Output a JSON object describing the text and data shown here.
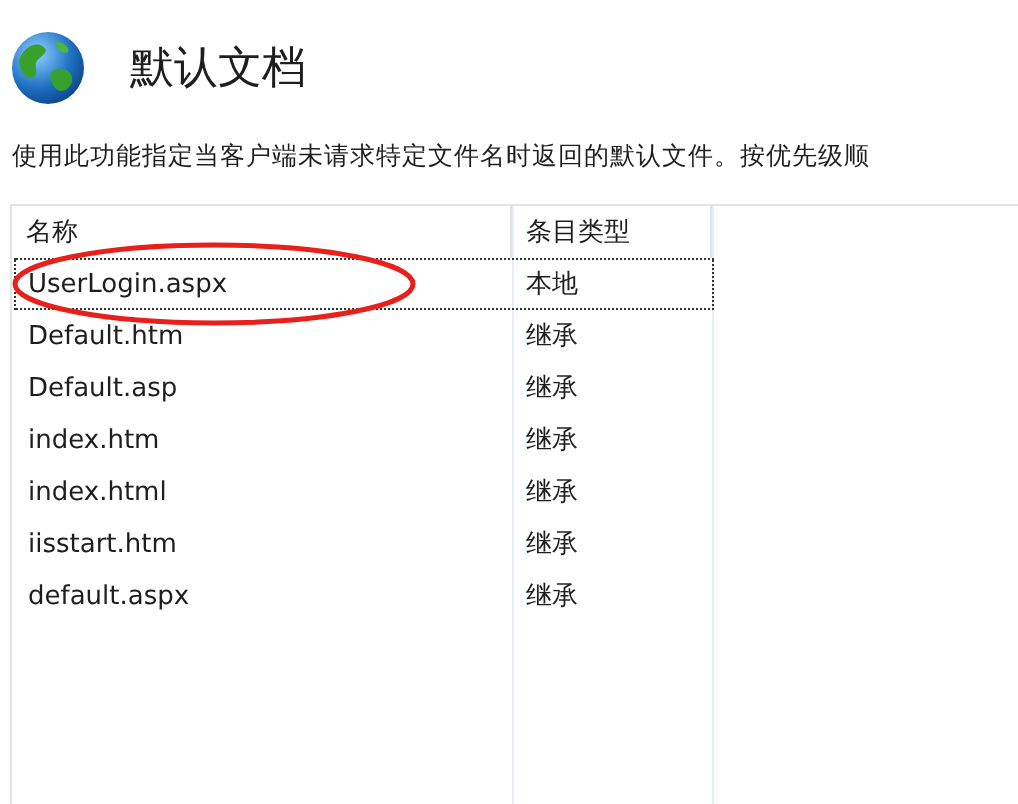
{
  "header": {
    "title": "默认文档"
  },
  "description": "使用此功能指定当客户端未请求特定文件名时返回的默认文件。按优先级顺",
  "table": {
    "columns": [
      "名称",
      "条目类型"
    ],
    "rows": [
      {
        "cells": [
          "UserLogin.aspx",
          "本地"
        ],
        "focused": true,
        "circled": true
      },
      {
        "cells": [
          "Default.htm",
          "继承"
        ],
        "focused": false,
        "circled": false
      },
      {
        "cells": [
          "Default.asp",
          "继承"
        ],
        "focused": false,
        "circled": false
      },
      {
        "cells": [
          "index.htm",
          "继承"
        ],
        "focused": false,
        "circled": false
      },
      {
        "cells": [
          "index.html",
          "继承"
        ],
        "focused": false,
        "circled": false
      },
      {
        "cells": [
          "iisstart.htm",
          "继承"
        ],
        "focused": false,
        "circled": false
      },
      {
        "cells": [
          "default.aspx",
          "继承"
        ],
        "focused": false,
        "circled": false
      }
    ]
  }
}
